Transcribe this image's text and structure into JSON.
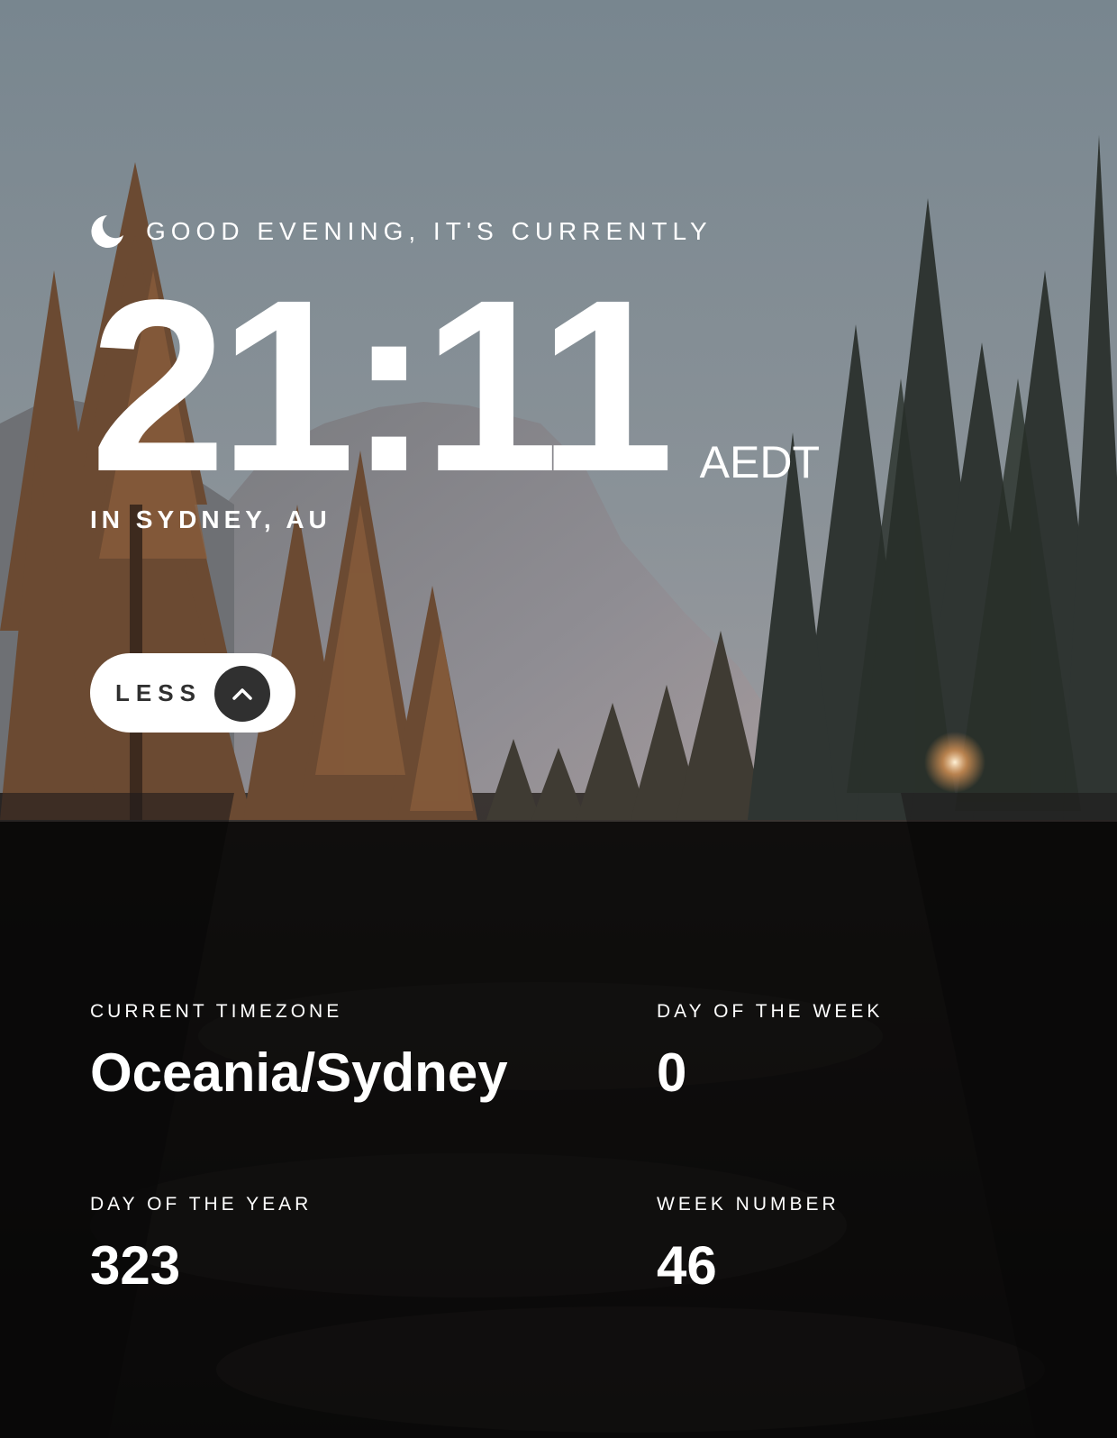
{
  "colors": {
    "text": "#ffffff",
    "button_bg": "#ffffff",
    "button_text": "#303030",
    "button_icon_bg": "#303030",
    "panel_overlay": "rgba(0,0,0,0.72)"
  },
  "icons": {
    "greeting": "moon-icon",
    "toggle": "chevron-up-icon"
  },
  "greeting": {
    "text": "GOOD EVENING, IT'S CURRENTLY"
  },
  "clock": {
    "time": "21:11",
    "abbreviation": "AEDT",
    "location": "IN SYDNEY, AU"
  },
  "toggle": {
    "label": "LESS"
  },
  "details": {
    "timezone": {
      "label": "CURRENT TIMEZONE",
      "value": "Oceania/Sydney"
    },
    "day_of_week": {
      "label": "DAY OF THE WEEK",
      "value": "0"
    },
    "day_of_year": {
      "label": "DAY OF THE YEAR",
      "value": "323"
    },
    "week_number": {
      "label": "WEEK NUMBER",
      "value": "46"
    }
  }
}
